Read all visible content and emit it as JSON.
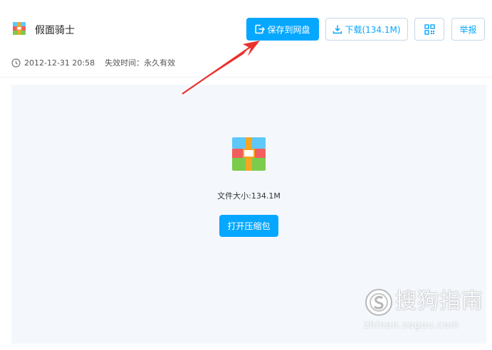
{
  "file": {
    "name": "假面骑士",
    "icon": "archive-icon"
  },
  "toolbar": {
    "save_label": "保存到网盘",
    "download_label": "下载(134.1M)",
    "qr_icon": "qr-code-icon",
    "report_label": "举报"
  },
  "meta": {
    "date": "2012-12-31 20:58",
    "expire_label": "失效时间：永久有效"
  },
  "main": {
    "size_label": "文件大小:134.1M",
    "open_label": "打开压缩包"
  },
  "watermark": {
    "brand": "搜狗指南",
    "domain": "zhinan.sogou.com"
  },
  "colors": {
    "accent": "#06a7ff",
    "panel_bg": "#f4f8fd",
    "annotation_arrow": "#e8322d"
  }
}
